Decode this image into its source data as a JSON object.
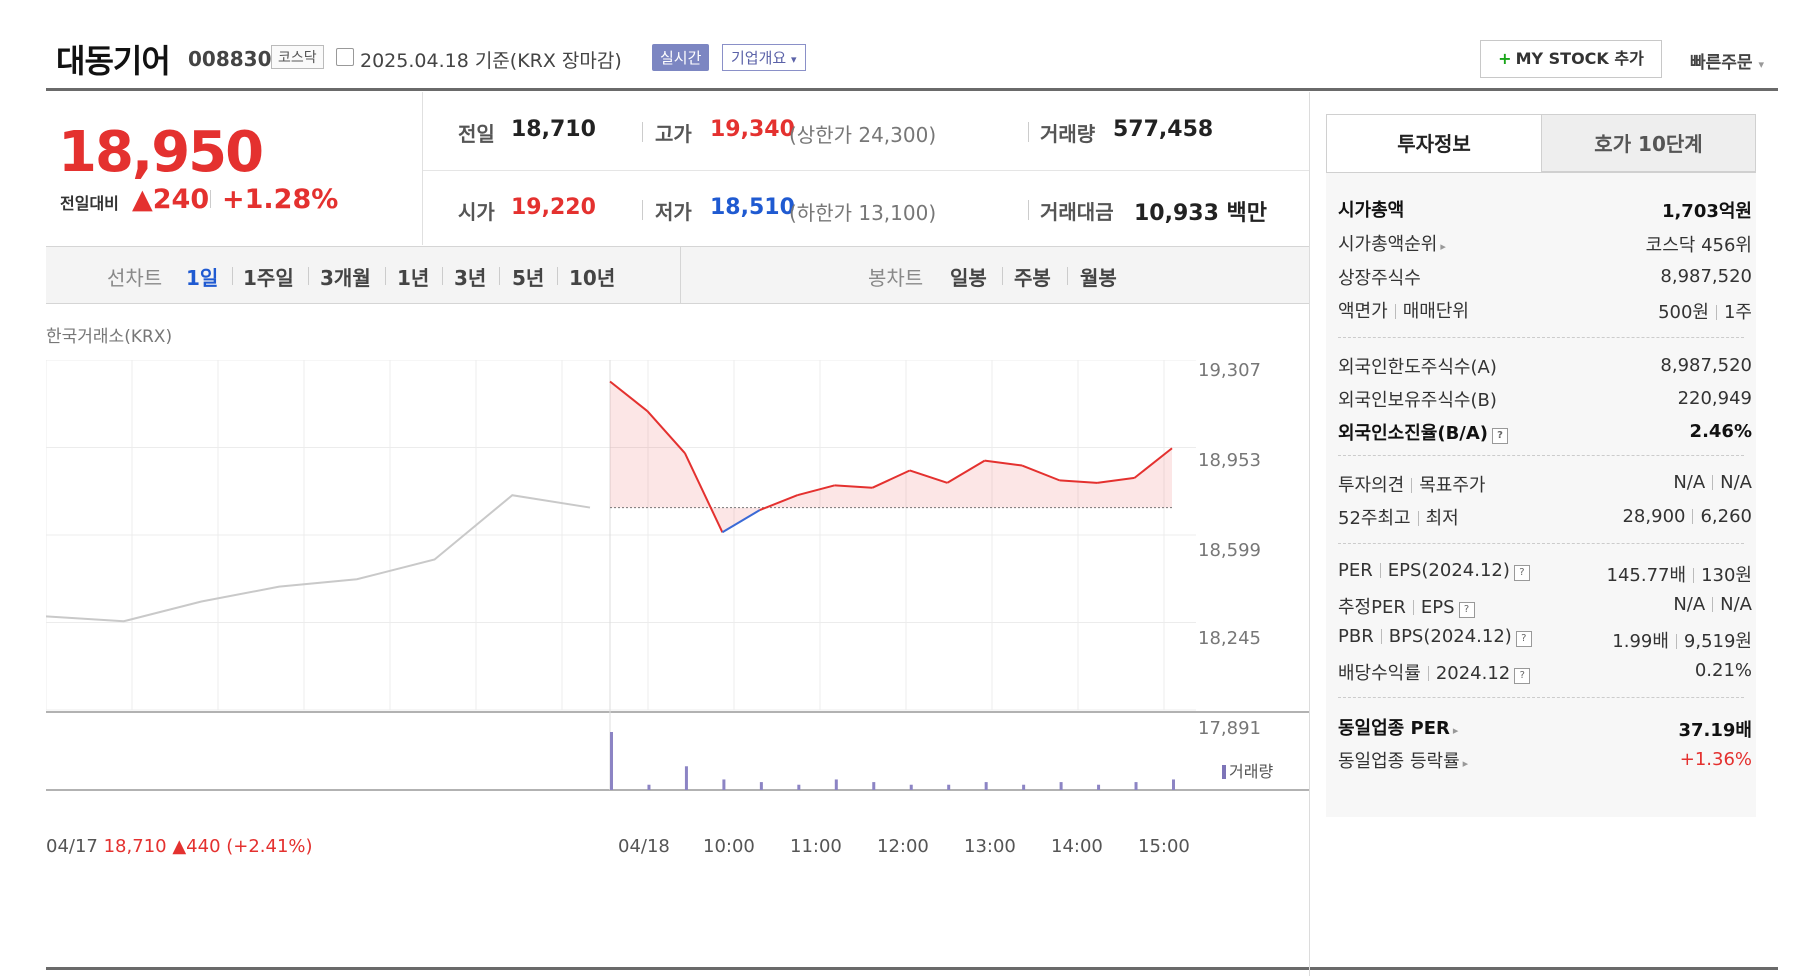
{
  "header": {
    "name": "대동기어",
    "code": "008830",
    "market": "코스닥",
    "date_basis": "2025.04.18  기준(KRX 장마감)",
    "realtime": "실시간",
    "company_info": "기업개요",
    "mystock": "MY STOCK 추가",
    "quick_order": "빠른주문"
  },
  "price": {
    "current": "18,950",
    "prev_label": "전일대비",
    "change": "▲240",
    "change_pct": "+1.28%"
  },
  "quote": {
    "prev_close_label": "전일",
    "prev_close": "18,710",
    "high_label": "고가",
    "high": "19,340",
    "upper_limit": "(상한가 24,300)",
    "volume_label": "거래량",
    "volume": "577,458",
    "open_label": "시가",
    "open": "19,220",
    "low_label": "저가",
    "low": "18,510",
    "lower_limit": "(하한가 13,100)",
    "amount_label": "거래대금",
    "amount": "10,933 백만"
  },
  "tabs": {
    "line_label": "선차트",
    "line_items": [
      "1일",
      "1주일",
      "3개월",
      "1년",
      "3년",
      "5년",
      "10년"
    ],
    "candle_label": "봉차트",
    "candle_items": [
      "일봉",
      "주봉",
      "월봉"
    ]
  },
  "chart_data": {
    "type": "line",
    "source_label": "한국거래소(KRX)",
    "y_ticks": [
      "19,307",
      "18,953",
      "18,599",
      "18,245",
      "17,891"
    ],
    "ylim": [
      17891,
      19307
    ],
    "x_ticks": [
      "04/18",
      "10:00",
      "11:00",
      "12:00",
      "13:00",
      "14:00",
      "15:00"
    ],
    "prev_day_label": "04/17",
    "prev_day_price": "18,710",
    "prev_day_change": "▲440 (+2.41%)",
    "volume_legend": "거래량",
    "baseline": 18710,
    "series": [
      {
        "x": [
          "04/17 09:00",
          "04/17 10:00",
          "04/17 11:00",
          "04/17 12:00",
          "04/17 13:00",
          "04/17 14:00",
          "04/17 15:00",
          "04/17 15:30"
        ],
        "values": [
          18270,
          18250,
          18330,
          18390,
          18420,
          18500,
          18760,
          18710
        ]
      },
      {
        "x": [
          "04/18 09:00",
          "09:05",
          "09:30",
          "10:00",
          "10:10",
          "10:30",
          "11:00",
          "11:30",
          "12:00",
          "12:30",
          "13:00",
          "13:30",
          "14:00",
          "14:30",
          "15:00",
          "15:30"
        ],
        "values": [
          19220,
          19100,
          18930,
          18610,
          18700,
          18760,
          18800,
          18790,
          18860,
          18810,
          18900,
          18880,
          18820,
          18810,
          18830,
          18950
        ]
      }
    ],
    "volume_series": [
      22,
      2,
      9,
      4,
      3,
      2,
      4,
      3,
      2,
      2,
      3,
      2,
      3,
      2,
      3,
      4
    ]
  },
  "panel": {
    "tab_invest": "투자정보",
    "tab_order10": "호가 10단계",
    "market_cap_label": "시가총액",
    "market_cap": "1,703억원",
    "cap_rank_label": "시가총액순위",
    "cap_rank": "코스닥 456위",
    "listed_shares_label": "상장주식수",
    "listed_shares": "8,987,520",
    "face_label": "액면가",
    "trade_unit_label": "매매단위",
    "face_value": "500원",
    "trade_unit": "1주",
    "foreign_limit_label": "외국인한도주식수(A)",
    "foreign_limit": "8,987,520",
    "foreign_hold_label": "외국인보유주식수(B)",
    "foreign_hold": "220,949",
    "foreign_ratio_label": "외국인소진율(B/A)",
    "foreign_ratio": "2.46%",
    "opinion_label": "투자의견",
    "target_label": "목표주가",
    "opinion": "N/A",
    "target": "N/A",
    "w52_label": "52주최고",
    "w52_low_label": "최저",
    "w52_high": "28,900",
    "w52_low": "6,260",
    "per_label": "PER",
    "eps_label": "EPS(2024.12)",
    "per": "145.77배",
    "eps": "130원",
    "est_per_label": "추정PER",
    "est_eps_label": "EPS",
    "est_per": "N/A",
    "est_eps": "N/A",
    "pbr_label": "PBR",
    "bps_label": "BPS(2024.12)",
    "pbr": "1.99배",
    "bps": "9,519원",
    "div_label": "배당수익률",
    "div_date": "2024.12",
    "div": "0.21%",
    "sector_per_label": "동일업종 PER",
    "sector_per": "37.19배",
    "sector_chg_label": "동일업종 등락률",
    "sector_chg": "+1.36%"
  }
}
